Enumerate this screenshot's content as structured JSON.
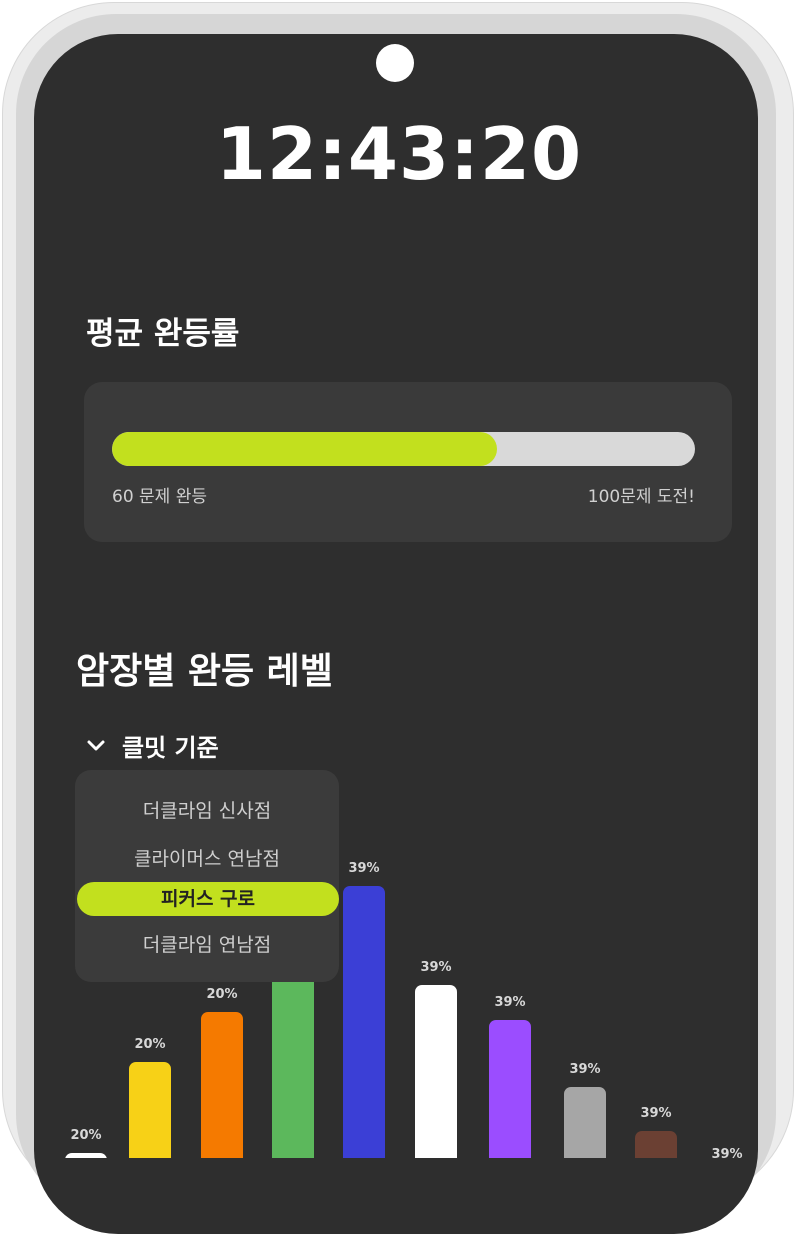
{
  "clock": "12:43:20",
  "average": {
    "title": "평균 완등률",
    "progress": 0.66,
    "left_label": "60 문제 완등",
    "right_label": "100문제 도전!",
    "colors": {
      "fill": "#c2e01e",
      "track": "#d9d9d9"
    }
  },
  "levels": {
    "title": "암장별 완등 레벨",
    "dropdown_label": "클밋 기준",
    "options": [
      "더클라임 신사점",
      "클라이머스 연남점",
      "피커스 구로",
      "더클라임 연남점"
    ],
    "selected_index": 2
  },
  "chart_data": {
    "type": "bar",
    "values": [
      20,
      20,
      20,
      20,
      39,
      39,
      39,
      39,
      39,
      39
    ],
    "labels": [
      "20%",
      "20%",
      "20%",
      "20%",
      "39%",
      "39%",
      "39%",
      "39%",
      "39%",
      "39%"
    ],
    "colors": [
      "#ffffff",
      "#f7d117",
      "#f57a00",
      "#5cb85c",
      "#3b3fd6",
      "#ffffff",
      "#9b4dff",
      "#a6a6a6",
      "#6b4033",
      "#ffffff"
    ]
  }
}
